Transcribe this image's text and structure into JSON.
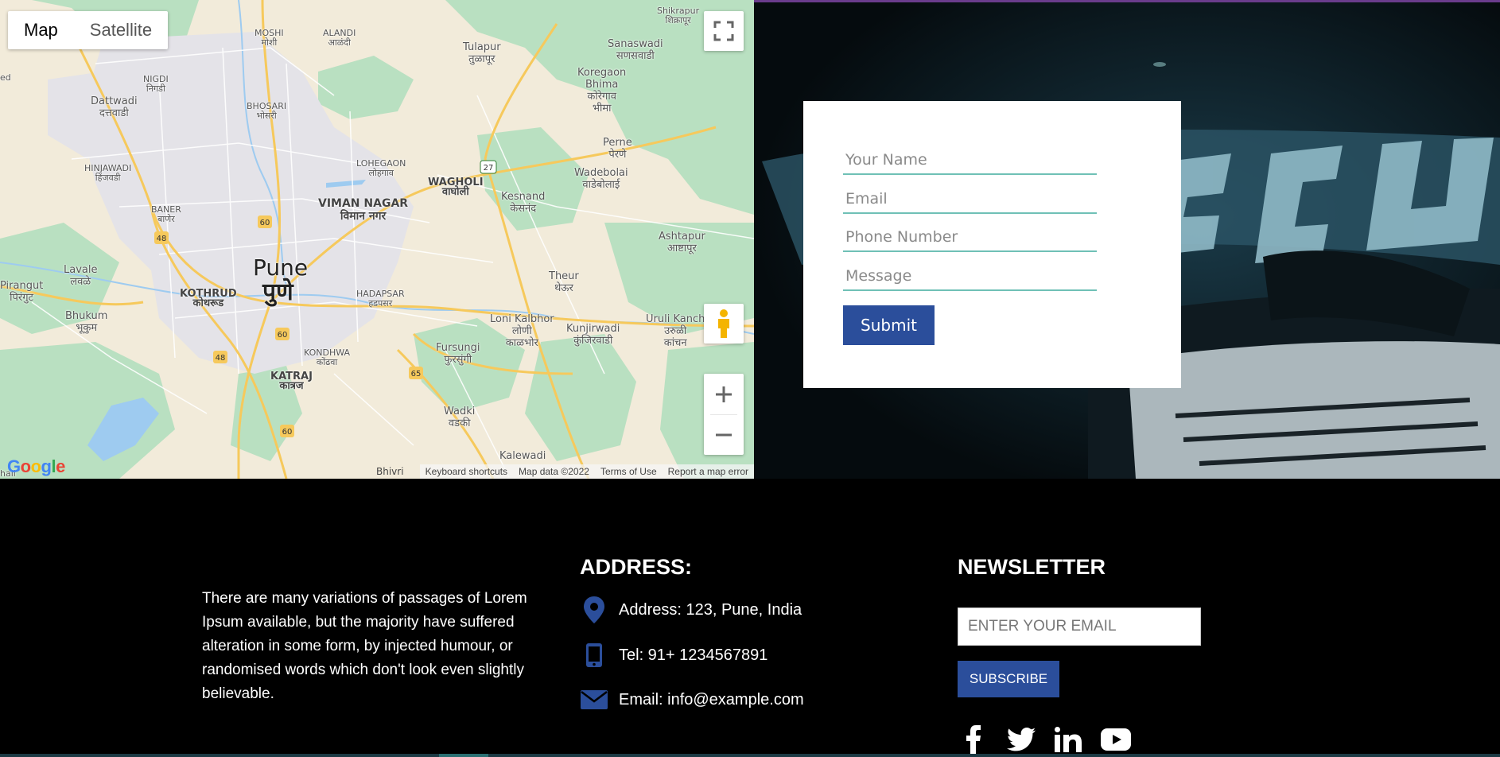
{
  "map": {
    "type_tabs": [
      {
        "label": "Map",
        "active": true
      },
      {
        "label": "Satellite",
        "active": false
      }
    ],
    "labels": {
      "shikrapur": "Shikrapur\nशिक्रापूर",
      "moshi": "MOSHI\nमोशी",
      "alandi": "ALANDI\nआळंदी",
      "tulapur": "Tulapur\nतुळापूर",
      "sanaswadi": "Sanaswadi\nसणसवाडी",
      "nigdi": "NIGDI\nनिगडी",
      "koregaon": "Koregaon\nBhima\nकोरेगाव\nभीमा",
      "dattwadi": "Dattwadi\nदत्तवाडी",
      "bhosari": "BHOSARI\nभोसरी",
      "perne": "Perne\nपेरणे",
      "hinjawadi": "HINJAWADI\nहिंजवडी",
      "lohegaon": "LOHEGAON\nलोहगाव",
      "wagholi": "WAGHOLI\nवाघोली",
      "kesnand": "Kesnand\nकेसनंद",
      "wadebolai": "Wadebolai\nवाडेबोलाई",
      "baner": "BANER\nबाणेर",
      "vimannagar": "VIMAN NAGAR\nविमान नगर",
      "ashtapur": "Ashtapur\nआष्टापूर",
      "lavale": "Lavale\nलवळे",
      "pune": "Pune",
      "pune_mr": "पुणे",
      "pirangut": "Pirangut\nपिरंगुट",
      "kothrud": "KOTHRUD\nकोथरूड",
      "hadapsar": "HADAPSAR\nहडपसर",
      "theur": "Theur\nथेऊर",
      "bhukum": "Bhukum\nभूकुम",
      "lonikalbhor": "Loni Kalbhor\nलोणी\nकाळभोर",
      "kunjirwadi": "Kunjirwadi\nकुंजिरवाडी",
      "urulikanchan": "Uruli Kanch\nउरुळी\nकांचन",
      "kondhwa": "KONDHWA\nकोंढवा",
      "fursungi": "Fursungi\nफुरसुंगी",
      "katraj": "KATRAJ\nकात्रज",
      "wadki": "Wadki\nवडकी",
      "kalewadi": "Kalewadi",
      "hali": "hali",
      "ed": "ed"
    },
    "route_shields": {
      "r27": "27",
      "r60a": "60",
      "r48a": "48",
      "r60b": "60",
      "r48b": "48",
      "r65": "65",
      "r60c": "60"
    },
    "bhivri": "Bhivri",
    "google": "Google",
    "attribution": [
      "Keyboard shortcuts",
      "Map data ©2022",
      "Terms of Use",
      "Report a map error"
    ]
  },
  "form": {
    "name_placeholder": "Your Name",
    "email_placeholder": "Email",
    "phone_placeholder": "Phone Number",
    "message_placeholder": "Message",
    "submit_label": "Submit"
  },
  "footer": {
    "about_text": "There are many variations of passages of Lorem Ipsum available, but the majority have suffered alteration in some form, by injected humour, or randomised words which don't look even slightly believable.",
    "address_heading": "ADDRESS:",
    "address": "Address: 123, Pune, India",
    "tel": "Tel: 91+ 1234567891",
    "email": "Email: info@example.com",
    "newsletter_heading": "NEWSLETTER",
    "newsletter_placeholder": "ENTER YOUR EMAIL",
    "subscribe_label": "SUBSCRIBE",
    "social": [
      "facebook-icon",
      "twitter-icon",
      "linkedin-icon",
      "youtube-icon"
    ]
  },
  "colors": {
    "accent": "#2b4e9b",
    "field_underline": "#6fc0b6",
    "top_line": "#6a3c8c"
  }
}
